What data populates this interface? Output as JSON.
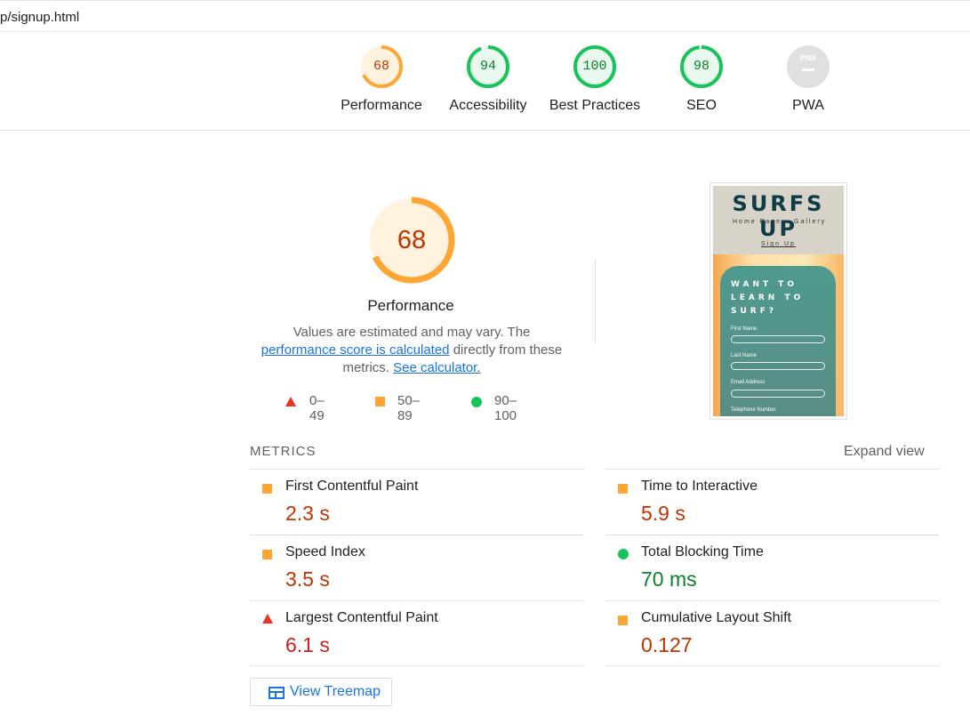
{
  "url": "p/signup.html",
  "categories": [
    {
      "score": "68",
      "label": "Performance",
      "status": "average"
    },
    {
      "score": "94",
      "label": "Accessibility",
      "status": "pass"
    },
    {
      "score": "100",
      "label": "Best Practices",
      "status": "pass"
    },
    {
      "score": "98",
      "label": "SEO",
      "status": "pass"
    },
    {
      "score": "PWA",
      "label": "PWA",
      "status": "na"
    }
  ],
  "colors": {
    "pass": "#18c35a",
    "average": "#ffa533",
    "fail": "#eb3223",
    "na": "#e0e0e0"
  },
  "performance": {
    "score": "68",
    "title": "Performance",
    "desc_prefix": "Values are estimated and may vary. The",
    "link_calc": "performance score is calculated",
    "desc_mid": "directly from these metrics.",
    "link_calculator": "See calculator."
  },
  "legend": {
    "fail": "0–49",
    "average": "50–89",
    "pass": "90–100"
  },
  "screenshot": {
    "brand": "SURFS UP",
    "nav_home": "Home Page",
    "nav_gallery": "Gallery",
    "nav_signup": "Sign Up",
    "heading_1": "WANT TO",
    "heading_2": "LEARN TO",
    "heading_3": "SURF?",
    "field_1": "First Name",
    "field_2": "Last Name",
    "field_3": "Email Address",
    "field_4": "Telephone Number"
  },
  "metrics": {
    "header": "METRICS",
    "expand": "Expand view",
    "items": [
      {
        "name": "First Contentful Paint",
        "value": "2.3 s",
        "status": "average"
      },
      {
        "name": "Time to Interactive",
        "value": "5.9 s",
        "status": "average"
      },
      {
        "name": "Speed Index",
        "value": "3.5 s",
        "status": "average"
      },
      {
        "name": "Total Blocking Time",
        "value": "70 ms",
        "status": "pass"
      },
      {
        "name": "Largest Contentful Paint",
        "value": "6.1 s",
        "status": "fail"
      },
      {
        "name": "Cumulative Layout Shift",
        "value": "0.127",
        "status": "average"
      }
    ]
  },
  "treemap": {
    "label": "View Treemap"
  }
}
